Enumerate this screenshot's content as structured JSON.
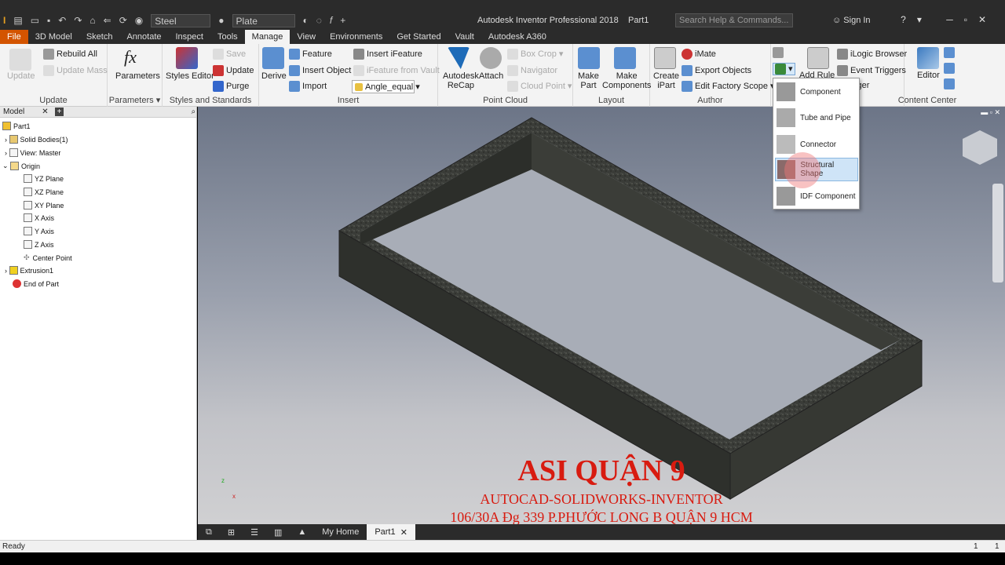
{
  "titlebar": {
    "material": "Steel",
    "appearance": "Plate",
    "title": "Autodesk Inventor Professional 2018",
    "doc": "Part1",
    "search_placeholder": "Search Help & Commands...",
    "signin": "Sign In"
  },
  "tabs": [
    "File",
    "3D Model",
    "Sketch",
    "Annotate",
    "Inspect",
    "Tools",
    "Manage",
    "View",
    "Environments",
    "Get Started",
    "Vault",
    "Autodesk A360"
  ],
  "ribbon": {
    "update": {
      "title": "Update",
      "update": "Update",
      "rebuild_all": "Rebuild All",
      "update_mass": "Update Mass"
    },
    "parameters": {
      "title": "Parameters",
      "parameters": "Parameters"
    },
    "styles": {
      "title": "Styles and Standards",
      "styles_editor": "Styles Editor",
      "save": "Save",
      "update": "Update",
      "purge": "Purge"
    },
    "insert": {
      "title": "Insert",
      "derive": "Derive",
      "feature": "Feature",
      "insert_object": "Insert Object",
      "import": "Import",
      "insert_ifeature": "Insert iFeature",
      "ifeature_from_vault": "iFeature from Vault",
      "angle_combo": "Angle_equal"
    },
    "pointcloud": {
      "title": "Point Cloud",
      "recap_1": "Autodesk",
      "recap_2": "ReCap",
      "attach": "Attach",
      "box_crop": "Box Crop",
      "navigator": "Navigator",
      "cloud_point": "Cloud Point"
    },
    "layout": {
      "title": "Layout",
      "make_part_1": "Make",
      "make_part_2": "Part",
      "make_components_1": "Make",
      "make_components_2": "Components"
    },
    "author": {
      "title": "Author",
      "create_ipart_1": "Create",
      "create_ipart_2": "iPart",
      "imate": "iMate",
      "export_objects": "Export Objects",
      "edit_factory_scope": "Edit Factory Scope"
    },
    "ilogic": {
      "add_rule": "Add Rule",
      "ilogic_browser": "iLogic Browser",
      "event_triggers": "Event Triggers",
      "trigger": "igger"
    },
    "content_center": {
      "title": "Content Center",
      "editor": "Editor"
    }
  },
  "dropdown": {
    "items": [
      "Component",
      "Tube and Pipe",
      "Connector",
      "Structural Shape",
      "IDF Component"
    ],
    "highlighted": "Structural Shape"
  },
  "browser": {
    "tab": "Model",
    "tree": [
      "Part1",
      "Solid Bodies(1)",
      "View: Master",
      "Origin",
      "YZ Plane",
      "XZ Plane",
      "XY Plane",
      "X Axis",
      "Y Axis",
      "Z Axis",
      "Center Point",
      "Extrusion1",
      "End of Part"
    ]
  },
  "watermark": {
    "line1": "ASI QUẬN 9",
    "line2": "AUTOCAD-SOLIDWORKS-INVENTOR",
    "line3": "106/30A Đg 339  P.PHƯỚC LONG B QUẬN 9 HCM"
  },
  "doc_tabs": {
    "home": "My Home",
    "part": "Part1"
  },
  "status": {
    "left": "Ready",
    "right1": "1",
    "right2": "1"
  },
  "colors": {
    "accent_file": "#d35400",
    "watermark": "#d81b10",
    "highlight": "#cfe4f7"
  }
}
